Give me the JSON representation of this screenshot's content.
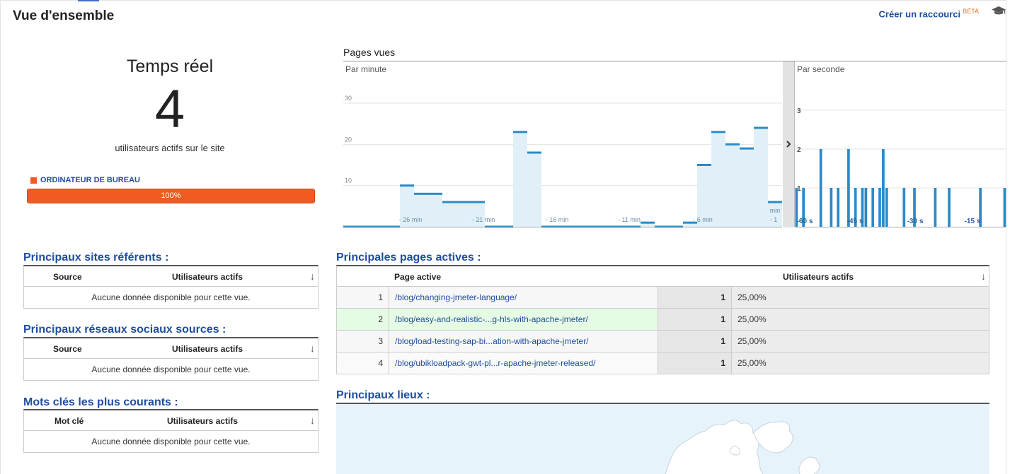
{
  "header": {
    "title": "Vue d'ensemble",
    "shortcut_label": "Créer un raccourci",
    "shortcut_badge": "BÉTA"
  },
  "realtime": {
    "title": "Temps réel",
    "active_users": "4",
    "subtitle": "utilisateurs actifs sur le site",
    "device_label": "ORDINATEUR DE BUREAU",
    "device_pct_label": "100%",
    "device_fraction": 1.0,
    "device_color": "#f15a22"
  },
  "chart": {
    "title": "Pages vues",
    "left_label": "Par minute",
    "right_label": "Par seconde",
    "chart_data": {
      "type": "bar",
      "panels": [
        {
          "name": "Par minute",
          "ylim": [
            0,
            30
          ],
          "yticks": [
            10,
            20,
            30
          ],
          "xticks": [
            "- 26 min",
            "- 21 min",
            "- 16 min",
            "- 11 min",
            "- 6 min",
            "- 1",
            "min"
          ],
          "values": [
            0,
            0,
            0,
            0,
            10,
            8,
            8,
            6,
            6,
            6,
            0,
            0,
            23,
            18,
            0,
            0,
            0,
            0,
            0,
            0,
            0,
            1,
            0,
            0,
            1,
            15,
            23,
            20,
            19,
            24,
            6
          ]
        },
        {
          "name": "Par seconde",
          "ylim": [
            0,
            3
          ],
          "yticks": [
            1,
            2,
            3
          ],
          "xticks": [
            "-60 s",
            "-45 s",
            "-30 s",
            "-15 s"
          ],
          "values": [
            1,
            0,
            1,
            0,
            0,
            0,
            0,
            2,
            0,
            0,
            1,
            0,
            1,
            0,
            0,
            2,
            0,
            1,
            0,
            1,
            1,
            0,
            1,
            0,
            1,
            2,
            1,
            0,
            0,
            0,
            0,
            1,
            0,
            0,
            1,
            0,
            0,
            0,
            0,
            0,
            1,
            0,
            0,
            0,
            1,
            0,
            0,
            0,
            0,
            0,
            0,
            0,
            0,
            1,
            0,
            0,
            0,
            0,
            0,
            0,
            1
          ]
        }
      ],
      "bar_color": "#2a8ac8",
      "fill_color": "#e1f0f8"
    }
  },
  "referrers": {
    "title": "Principaux sites référents :",
    "col1": "Source",
    "col2": "Utilisateurs actifs",
    "sort_icon": "↓",
    "empty": "Aucune donnée disponible pour cette vue."
  },
  "social": {
    "title": "Principaux réseaux sociaux sources :",
    "col1": "Source",
    "col2": "Utilisateurs actifs",
    "sort_icon": "↓",
    "empty": "Aucune donnée disponible pour cette vue."
  },
  "keywords": {
    "title": "Mots clés les plus courants :",
    "col1": "Mot clé",
    "col2": "Utilisateurs actifs",
    "sort_icon": "↓",
    "empty": "Aucune donnée disponible pour cette vue."
  },
  "active_pages": {
    "title": "Principales pages actives :",
    "col_page": "Page active",
    "col_users": "Utilisateurs actifs",
    "sort_icon": "↓",
    "rows": [
      {
        "idx": "1",
        "page": "/blog/changing-jmeter-language/",
        "users": "1",
        "pct": "25,00%"
      },
      {
        "idx": "2",
        "page": "/blog/easy-and-realistic-...g-hls-with-apache-jmeter/",
        "users": "1",
        "pct": "25,00%"
      },
      {
        "idx": "3",
        "page": "/blog/load-testing-sap-bi...ation-with-apache-jmeter/",
        "users": "1",
        "pct": "25,00%"
      },
      {
        "idx": "4",
        "page": "/blog/ubikloadpack-gwt-pl...r-apache-jmeter-released/",
        "users": "1",
        "pct": "25,00%"
      }
    ]
  },
  "locations": {
    "title": "Principaux lieux :"
  }
}
